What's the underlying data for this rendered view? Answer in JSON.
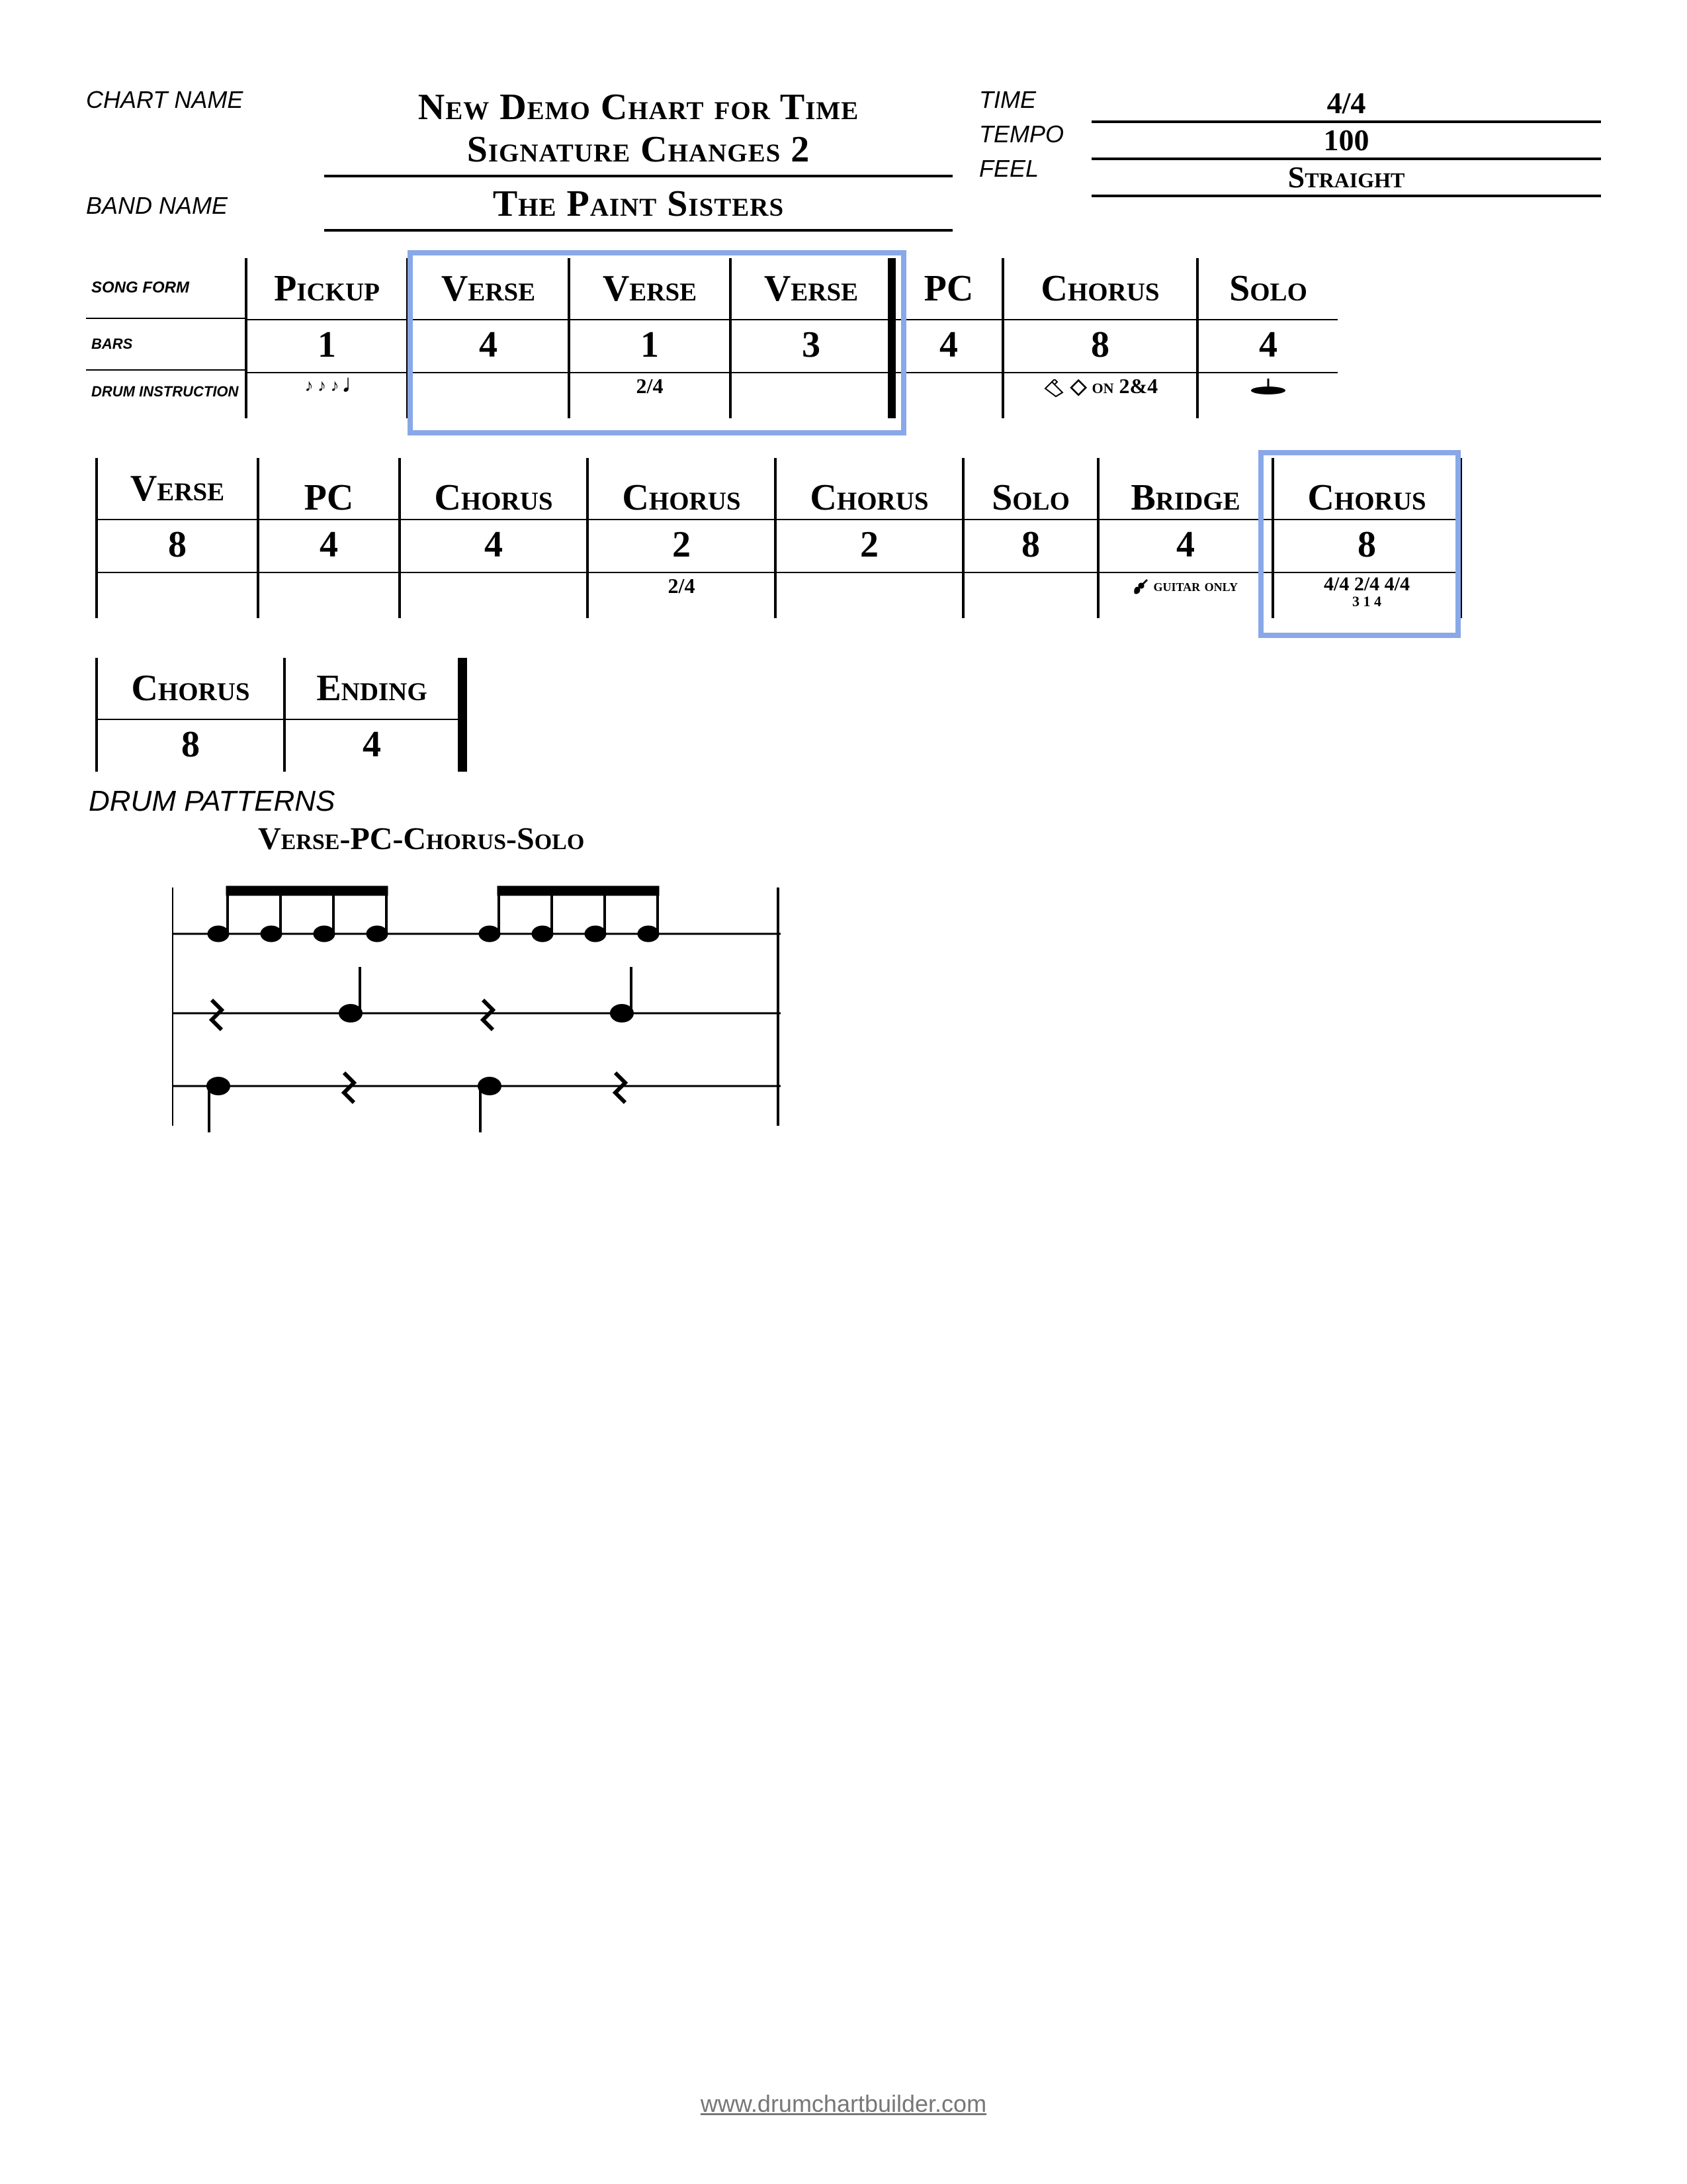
{
  "header": {
    "chart_name_label": "CHART NAME",
    "band_name_label": "BAND NAME",
    "title_l1": "New Demo Chart for Time",
    "title_l2": "Signature Changes 2",
    "band": "The Paint Sisters",
    "time_label": "TIME",
    "tempo_label": "TEMPO",
    "feel_label": "FEEL",
    "time": "4/4",
    "tempo": "100",
    "feel": "Straight"
  },
  "row_labels": {
    "song_form": "SONG FORM",
    "bars": "BARS",
    "drum": "DRUM INSTRUCTION"
  },
  "row1": [
    {
      "name": "Pickup",
      "bars": "1",
      "inst": "♪ ♪ ♪ 𝅘𝅥"
    },
    {
      "name": "Verse",
      "bars": "4",
      "inst": ""
    },
    {
      "name": "Verse",
      "bars": "1",
      "inst": "2/4"
    },
    {
      "name": "Verse",
      "bars": "3",
      "inst": ""
    },
    {
      "name": "PC",
      "bars": "4",
      "inst": ""
    },
    {
      "name": "Chorus",
      "bars": "8",
      "inst": "◇ on 2&4",
      "icon": "cowbell"
    },
    {
      "name": "Solo",
      "bars": "4",
      "inst": "",
      "icon": "cymbal"
    }
  ],
  "row2": [
    {
      "name": "Verse",
      "bars": "8",
      "inst": ""
    },
    {
      "name": "PC",
      "bars": "4",
      "inst": ""
    },
    {
      "name": "Chorus",
      "bars": "4",
      "inst": ""
    },
    {
      "name": "Chorus",
      "bars": "2",
      "inst": "2/4"
    },
    {
      "name": "Chorus",
      "bars": "2",
      "inst": ""
    },
    {
      "name": "Solo",
      "bars": "8",
      "inst": ""
    },
    {
      "name": "Bridge",
      "bars": "4",
      "inst": "guitar only",
      "icon": "guitar"
    },
    {
      "name": "Chorus",
      "bars": "8",
      "inst": "4/4 2/4 4/4",
      "sub": "3   1   4"
    }
  ],
  "row3": [
    {
      "name": "Chorus",
      "bars": "8"
    },
    {
      "name": "Ending",
      "bars": "4"
    }
  ],
  "patterns_label": "DRUM PATTERNS",
  "pattern_title": "Verse-PC-Chorus-Solo",
  "footer": "www.drumchartbuilder.com"
}
